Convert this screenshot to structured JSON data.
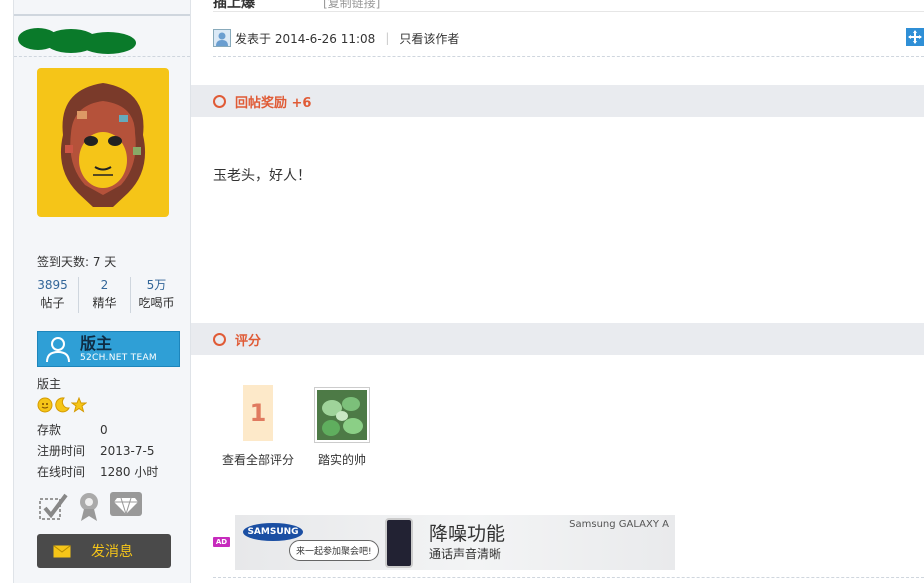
{
  "topbar": {
    "title_fragment": "插上爆",
    "edit_fragment": "[复制链接]"
  },
  "author": {
    "sign_days_label": "签到天数: 7 天",
    "stats": [
      {
        "value": "3895",
        "label": "帖子"
      },
      {
        "value": "2",
        "label": "精华"
      },
      {
        "value": "5万",
        "label": "吃喝币"
      }
    ],
    "rank_badge": {
      "title": "版主",
      "subtitle": "52CH.NET TEAM"
    },
    "rank_name": "版主",
    "info": [
      {
        "key": "存款",
        "value": "0"
      },
      {
        "key": "注册时间",
        "value": "2013-7-5"
      },
      {
        "key": "在线时间",
        "value": "1280 小时"
      }
    ],
    "send_message_label": "发消息"
  },
  "post": {
    "posted_at": "发表于 2014-6-26 11:08",
    "only_author_label": "只看该作者",
    "reward_title": "回帖奖励 +6",
    "body": "玉老头，好人！",
    "rating_title": "评分",
    "rating_count": "1",
    "view_all_ratings": "查看全部评分",
    "rater_name": "踏实的帅"
  },
  "ad": {
    "tag": "AD",
    "brand_logo": "SAMSUNG",
    "bubble": "来一起参加聚会吧!",
    "headline": "降噪功能",
    "subline": "通话声音清晰",
    "product": "Samsung GALAXY A"
  },
  "colors": {
    "accent": "#e05b36",
    "link": "#336699",
    "badge": "#2f9fd6",
    "button": "#4a4a4a",
    "button_text": "#f5c518"
  }
}
